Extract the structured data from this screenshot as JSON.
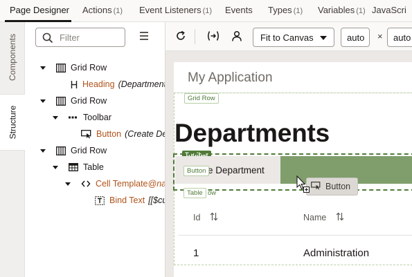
{
  "tabs": [
    {
      "label": "Page Designer",
      "count": ""
    },
    {
      "label": "Actions",
      "count": "(1)"
    },
    {
      "label": "Event Listeners",
      "count": "(1)"
    },
    {
      "label": "Events",
      "count": ""
    },
    {
      "label": "Types",
      "count": "(1)"
    },
    {
      "label": "Variables",
      "count": "(1)"
    },
    {
      "label": "JavaScri",
      "count": ""
    }
  ],
  "side_tabs": {
    "components": "Components",
    "structure": "Structure"
  },
  "filter": {
    "placeholder": "Filter",
    "value": ""
  },
  "tree": [
    {
      "label": "Grid Row",
      "meta": ""
    },
    {
      "label": "Heading",
      "meta": "(Department"
    },
    {
      "label": "Grid Row",
      "meta": ""
    },
    {
      "label": "Toolbar",
      "meta": ""
    },
    {
      "label": "Button",
      "meta": "(Create Dep"
    },
    {
      "label": "Grid Row",
      "meta": ""
    },
    {
      "label": "Table",
      "meta": ""
    },
    {
      "label": "Cell Template",
      "meta": "@na"
    },
    {
      "label": "Bind Text",
      "meta": "[[$cu"
    }
  ],
  "canvas_toolbar": {
    "fit_select": "Fit to Canvas",
    "width_value": "auto",
    "times": "×",
    "height_value": "auto"
  },
  "canvas": {
    "app_title": "My Application",
    "tags": {
      "grid_row": "Grid Row",
      "toolbar": "Toolbar",
      "button": "Button",
      "table": "Table",
      "row_partial": "ow"
    },
    "heading": "Departments",
    "create_button": "Create Department",
    "drop_button": "Button",
    "table": {
      "columns": [
        "Id",
        "Name"
      ],
      "rows": [
        [
          "1",
          "Administration"
        ]
      ]
    }
  },
  "colors": {
    "accent_green": "#4f7a37",
    "drop_zone": "#7f9e6c",
    "link_orange": "#b0531a"
  }
}
